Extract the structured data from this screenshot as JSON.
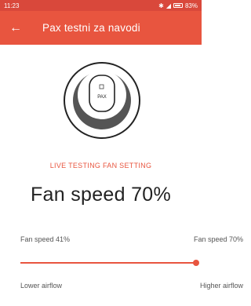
{
  "statusbar": {
    "time": "11:23",
    "battery": "83%"
  },
  "appbar": {
    "back_icon": "arrow-left-icon",
    "title": "Pax testni za navodi"
  },
  "device": {
    "label": "PAX"
  },
  "live_label": "LIVE TESTING FAN SETTING",
  "fan_speed_heading": "Fan speed 70%",
  "range": {
    "min_label": "Fan speed 41%",
    "max_label": "Fan speed 70%",
    "value_fraction": 1.0
  },
  "airflow": {
    "lower": "Lower airflow",
    "higher": "Higher airflow"
  },
  "colors": {
    "accent": "#e8553f"
  }
}
